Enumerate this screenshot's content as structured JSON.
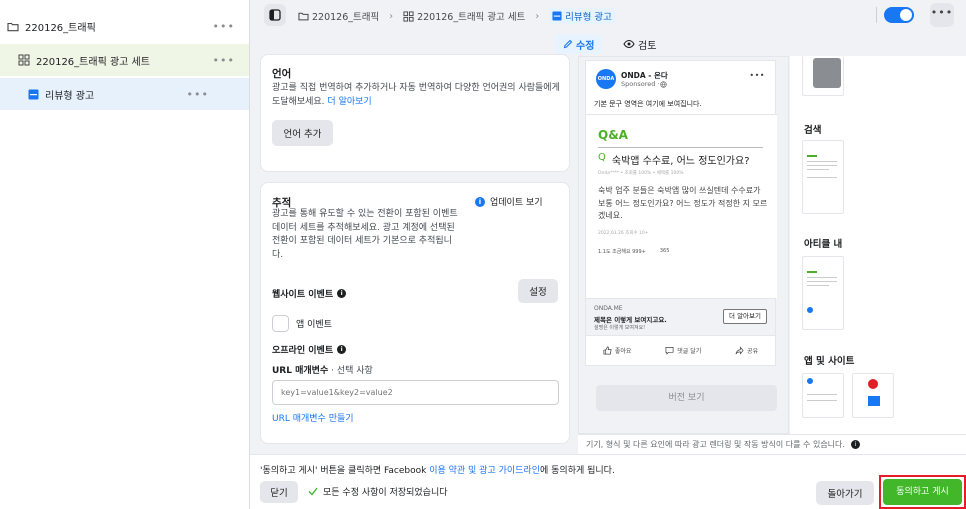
{
  "sidebar": {
    "items": [
      {
        "label": "220126_트래픽",
        "more": "•••"
      },
      {
        "label": "220126_트래픽 광고 세트",
        "more": "•••"
      },
      {
        "label": "리뷰형 광고",
        "more": "•••"
      }
    ]
  },
  "topbar": {
    "crumbs": [
      "220126_트래픽",
      "220126_트래픽 광고 세트",
      "리뷰형 광고"
    ],
    "more": "•••"
  },
  "tabs": {
    "edit": "수정",
    "review": "검토"
  },
  "language": {
    "title": "언어",
    "desc": "광고를 직접 번역하여 추가하거나 자동 번역하여 다양한 언어권의 사람들에게 도달해보세요.",
    "learn_more": "더 알아보기",
    "add_button": "언어 추가"
  },
  "tracking": {
    "title": "추적",
    "update_link": "업데이트 보기",
    "desc": "광고를 통해 유도할 수 있는 전환이 포함된 이벤트 데이터 세트를 추적해보세요. 광고 계정에 선택된 전환이 포함된 데이터 세트가 기본으로 추적됩니다.",
    "website_events": "웹사이트 이벤트",
    "settings_button": "설정",
    "app_events": "앱 이벤트",
    "offline_events": "오프라인 이벤트",
    "url_params_label": "URL 매개변수",
    "url_params_optional": " · 선택 사항",
    "url_params_placeholder": "key1=value1&key2=value2",
    "url_params_builder": "URL 매개변수 만들기"
  },
  "ad_preview": {
    "page_name": "ONDA - 온다",
    "sponsored": "Sponsored · ",
    "logo_text": "ONDA",
    "more": "•••",
    "primary_text": "기본 문구 영역은 여기에 보여집니다.",
    "qa_label": "Q&A",
    "q_mark": "Q",
    "question": "숙박앱 수수료, 어느 정도인가요?",
    "meta_line": "Onda**** • 조회률 100% • 채택률 100%",
    "answer": "숙박 업주 분들은 숙박앱 많이 쓰실텐데 수수료가 보통 어느 정도인가요? 어느 정도가 적정한 지 모르겠네요.",
    "date_line": "2022.01.26 조회수 10+",
    "likes": "1.1도 조금해요 999+",
    "comments": "365",
    "domain": "ONDA.ME",
    "headline": "제목은 이렇게 보여지고요.",
    "description": "설명은 이렇게 보여져요!",
    "cta": "더 알아보기",
    "like": "좋아요",
    "comment": "댓글 달기",
    "share": "공유",
    "version_button": "버전 보기"
  },
  "preview_note": "기기, 형식 및 다른 요인에 따라 광고 렌더링 및 작동 방식이 다를 수 있습니다.",
  "placements": {
    "search": "검색",
    "article": "아티클 내",
    "apps_sites": "앱 및 사이트"
  },
  "footer": {
    "terms_prefix": "'동의하고 게시' 버튼을 클릭하면 Facebook ",
    "terms_link": "이용 약관 및 광고 가이드라인",
    "terms_suffix": "에 동의하게 됩니다.",
    "close_button": "닫기",
    "saved_status": "모든 수정 사항이 저장되었습니다",
    "back_button": "돌아가기",
    "publish_button": "동의하고 게시"
  },
  "colors": {
    "accent": "#1877f2",
    "publish": "#42b72a",
    "highlight": "#e41e26"
  }
}
